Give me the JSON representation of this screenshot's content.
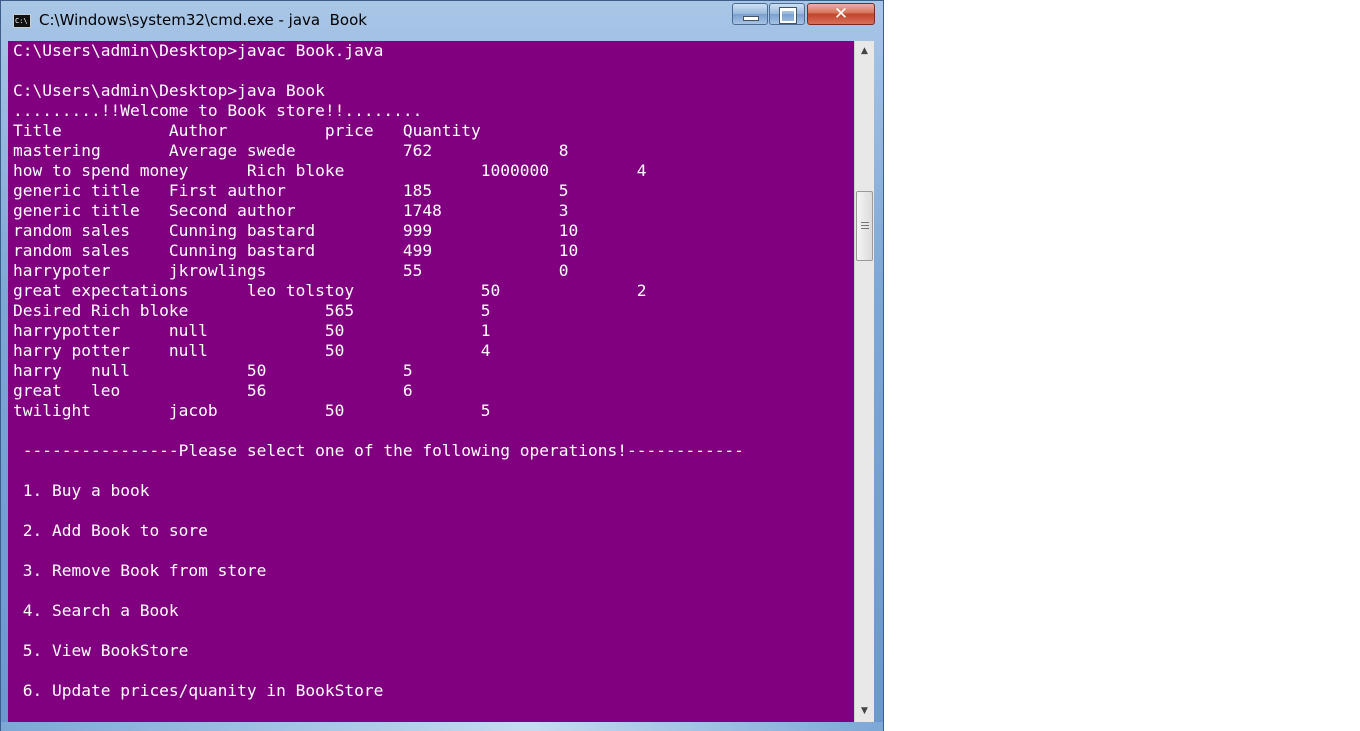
{
  "window": {
    "title": "C:\\Windows\\system32\\cmd.exe - java  Book",
    "icon_text": "C:\\",
    "buttons": {
      "minimize_icon": "minimize-icon",
      "maximize_icon": "maximize-icon",
      "close_glyph": "✕"
    }
  },
  "console": {
    "background_color": "#800080",
    "text_color": "#ffffff",
    "lines": [
      "C:\\Users\\admin\\Desktop>javac Book.java",
      "",
      "C:\\Users\\admin\\Desktop>java Book",
      ".........!!Welcome to Book store!!........",
      "Title           Author          price   Quantity",
      "mastering       Average swede           762             8",
      "how to spend money      Rich bloke              1000000         4",
      "generic title   First author            185             5",
      "generic title   Second author           1748            3",
      "random sales    Cunning bastard         999             10",
      "random sales    Cunning bastard         499             10",
      "harrypoter      jkrowlings              55              0",
      "great expectations      leo tolstoy             50              2",
      "Desired Rich bloke              565             5",
      "harrypotter     null            50              1",
      "harry potter    null            50              4",
      "harry   null            50              5",
      "great   leo             56              6",
      "twilight        jacob           50              5",
      "",
      " ----------------Please select one of the following operations!------------",
      "",
      " 1. Buy a book",
      "",
      " 2. Add Book to sore",
      "",
      " 3. Remove Book from store",
      "",
      " 4. Search a Book",
      "",
      " 5. View BookStore",
      "",
      " 6. Update prices/quanity in BookStore"
    ]
  },
  "scrollbar": {
    "up_arrow": "▲",
    "down_arrow": "▼"
  }
}
